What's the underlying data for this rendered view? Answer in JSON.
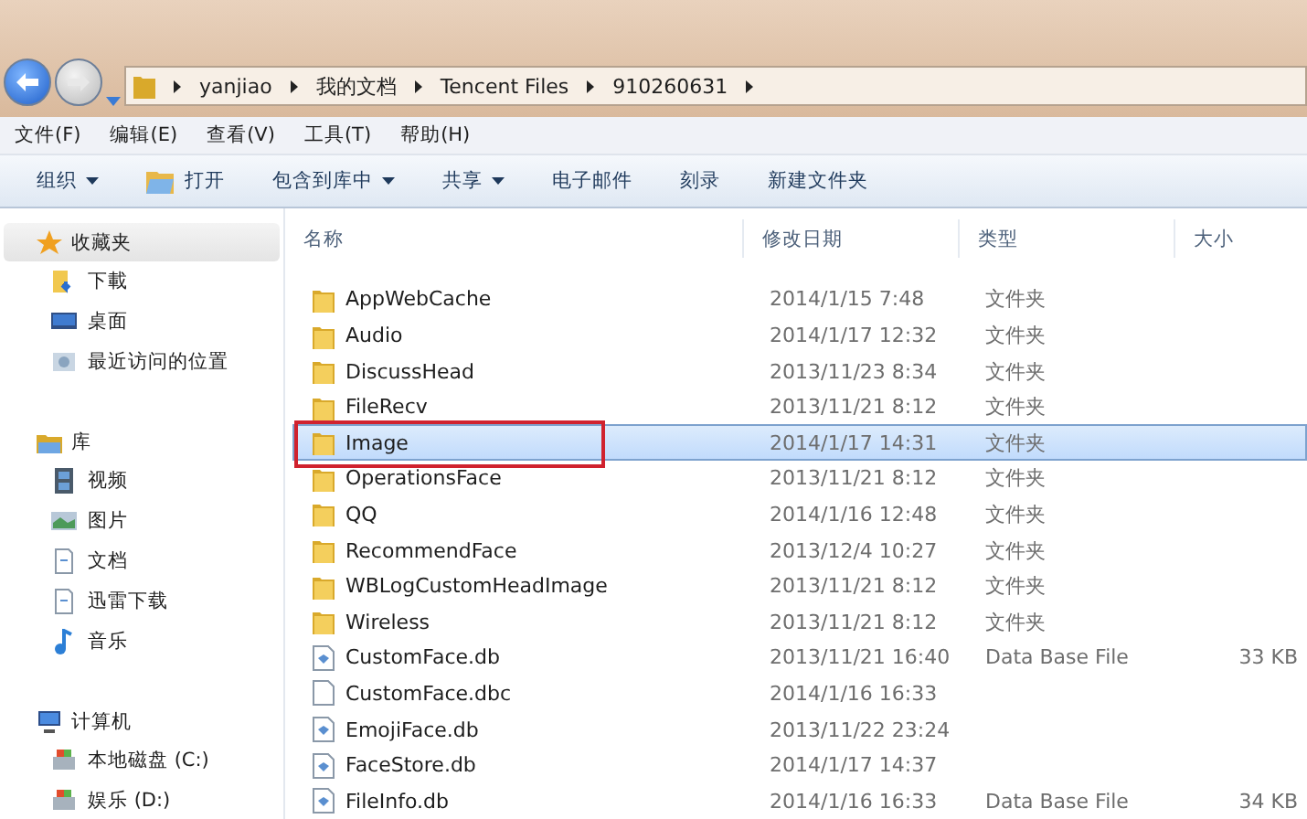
{
  "address_bar": {
    "segments": [
      "yanjiao",
      "我的文档",
      "Tencent Files",
      "910260631"
    ]
  },
  "menu_bar": [
    "文件(F)",
    "编辑(E)",
    "查看(V)",
    "工具(T)",
    "帮助(H)"
  ],
  "toolbar": [
    {
      "label": "组织",
      "kind": "dropdown"
    },
    {
      "label": "打开",
      "kind": "icon"
    },
    {
      "label": "包含到库中",
      "kind": "dropdown"
    },
    {
      "label": "共享",
      "kind": "dropdown"
    },
    {
      "label": "电子邮件",
      "kind": "plain"
    },
    {
      "label": "刻录",
      "kind": "plain"
    },
    {
      "label": "新建文件夹",
      "kind": "plain"
    }
  ],
  "sidebar": {
    "groups": [
      {
        "label": "收藏夹",
        "kind": "star",
        "selected": true,
        "children": [
          {
            "label": "下載",
            "kind": "download"
          },
          {
            "label": "桌面",
            "kind": "desktop"
          },
          {
            "label": "最近访问的位置",
            "kind": "recent"
          }
        ]
      },
      {
        "label": "库",
        "kind": "library",
        "selected": false,
        "children": [
          {
            "label": "视频",
            "kind": "video"
          },
          {
            "label": "图片",
            "kind": "image"
          },
          {
            "label": "文档",
            "kind": "doc"
          },
          {
            "label": "迅雷下载",
            "kind": "doc"
          },
          {
            "label": "音乐",
            "kind": "music"
          }
        ]
      },
      {
        "label": "计算机",
        "kind": "computer",
        "selected": false,
        "children": [
          {
            "label": "本地磁盘 (C:)",
            "kind": "drive"
          },
          {
            "label": "娱乐 (D:)",
            "kind": "drive"
          }
        ]
      }
    ]
  },
  "table": {
    "columns": [
      "名称",
      "修改日期",
      "类型",
      "大小"
    ],
    "rows": [
      {
        "name": "AppWebCache",
        "date": "2014/1/15 7:48",
        "type": "文件夹",
        "kind": "folder",
        "selected": false,
        "annotated": false
      },
      {
        "name": "Audio",
        "date": "2014/1/17 12:32",
        "type": "文件夹",
        "kind": "folder",
        "selected": false,
        "annotated": false
      },
      {
        "name": "DiscussHead",
        "date": "2013/11/23 8:34",
        "type": "文件夹",
        "kind": "folder",
        "selected": false,
        "annotated": false
      },
      {
        "name": "FileRecv",
        "date": "2013/11/21 8:12",
        "type": "文件夹",
        "kind": "folder",
        "selected": false,
        "annotated": false
      },
      {
        "name": "Image",
        "date": "2014/1/17 14:31",
        "type": "文件夹",
        "kind": "folder",
        "selected": true,
        "annotated": true
      },
      {
        "name": "OperationsFace",
        "date": "2013/11/21 8:12",
        "type": "文件夹",
        "kind": "folder",
        "selected": false,
        "annotated": false
      },
      {
        "name": "QQ",
        "date": "2014/1/16 12:48",
        "type": "文件夹",
        "kind": "folder",
        "selected": false,
        "annotated": false
      },
      {
        "name": "RecommendFace",
        "date": "2013/12/4 10:27",
        "type": "文件夹",
        "kind": "folder",
        "selected": false,
        "annotated": false
      },
      {
        "name": "WBLogCustomHeadImage",
        "date": "2013/11/21 8:12",
        "type": "文件夹",
        "kind": "folder",
        "selected": false,
        "annotated": false
      },
      {
        "name": "Wireless",
        "date": "2013/11/21 8:12",
        "type": "文件夹",
        "kind": "folder",
        "selected": false,
        "annotated": false
      },
      {
        "name": "CustomFace.db",
        "date": "2013/11/21 16:40",
        "type": "Data Base File",
        "size": "33 KB",
        "kind": "db",
        "selected": false,
        "annotated": false
      },
      {
        "name": "CustomFace.dbc",
        "date": "2014/1/16 16:33",
        "kind": "blank",
        "selected": false,
        "annotated": false
      },
      {
        "name": "EmojiFace.db",
        "date": "2013/11/22 23:24",
        "kind": "db",
        "selected": false,
        "annotated": false
      },
      {
        "name": "FaceStore.db",
        "date": "2014/1/17 14:37",
        "kind": "db",
        "selected": false,
        "annotated": false
      },
      {
        "name": "FileInfo.db",
        "date": "2014/1/16 16:33",
        "type": "Data Base File",
        "size": "34 KB",
        "kind": "db",
        "selected": false,
        "annotated": false
      }
    ]
  }
}
